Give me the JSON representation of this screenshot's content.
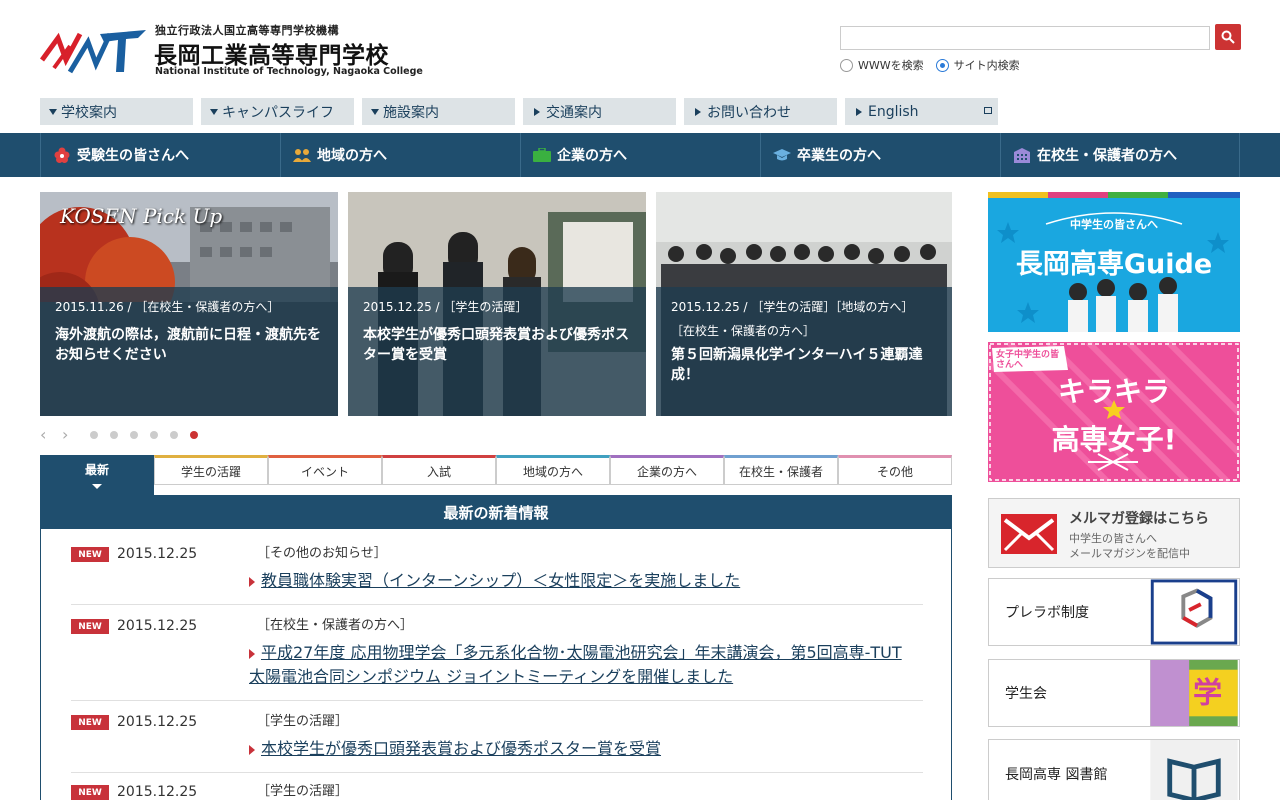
{
  "header": {
    "org": "独立行政法人国立高等専門学校機構",
    "title": "長岡工業高等専門学校",
    "title_en": "National Institute of Technology, Nagaoka College",
    "logo_text": "NCT",
    "search_placeholder": "",
    "radio_www": "WWWを検索",
    "radio_site": "サイト内検索"
  },
  "subnav": [
    {
      "label": "学校案内",
      "icon": "triangle-down-icon"
    },
    {
      "label": "キャンパスライフ",
      "icon": "triangle-down-icon"
    },
    {
      "label": "施設案内",
      "icon": "triangle-down-icon"
    },
    {
      "label": "交通案内",
      "icon": "triangle-right-icon"
    },
    {
      "label": "お問い合わせ",
      "icon": "triangle-right-icon"
    },
    {
      "label": "English",
      "icon": "triangle-right-icon"
    }
  ],
  "mainnav": [
    {
      "label": "受験生の皆さんへ",
      "icon": "flower-icon",
      "color": "#e04040"
    },
    {
      "label": "地域の方へ",
      "icon": "people-icon",
      "color": "#e8a93a"
    },
    {
      "label": "企業の方へ",
      "icon": "briefcase-icon",
      "color": "#3ab040"
    },
    {
      "label": "卒業生の方へ",
      "icon": "graduation-cap-icon",
      "color": "#6ab0e0"
    },
    {
      "label": "在校生・保護者の方へ",
      "icon": "building-icon",
      "color": "#9a8ad8"
    }
  ],
  "slides": [
    {
      "meta": "2015.11.26 / ［在校生・保護者の方へ］",
      "meta2": "",
      "title": "海外渡航の際は，渡航前に日程・渡航先をお知らせください",
      "banner": "KOSEN Pick Up"
    },
    {
      "meta": "2015.12.25 / ［学生の活躍］",
      "meta2": "",
      "title": "本校学生が優秀口頭発表賞および優秀ポスター賞を受賞"
    },
    {
      "meta": "2015.12.25 / ［学生の活躍］［地域の方へ］",
      "meta2": "［在校生・保護者の方へ］",
      "title": "第５回新潟県化学インターハイ５連覇達成！"
    }
  ],
  "slider_dots": 6,
  "slider_active_dot": 6,
  "tabs": [
    {
      "label": "最新",
      "color": "#1f4e6e"
    },
    {
      "label": "学生の活躍",
      "color": "#e0b040"
    },
    {
      "label": "イベント",
      "color": "#e06040"
    },
    {
      "label": "入試",
      "color": "#d04040"
    },
    {
      "label": "地域の方へ",
      "color": "#40a0c0"
    },
    {
      "label": "企業の方へ",
      "color": "#a070c0"
    },
    {
      "label": "在校生・保護者",
      "color": "#70a0d0"
    },
    {
      "label": "その他",
      "color": "#e090b0"
    }
  ],
  "news": {
    "heading": "最新の新着情報",
    "badge": "NEW",
    "items": [
      {
        "date": "2015.12.25",
        "category": "［その他のお知らせ］",
        "lines": [
          "教員職体験実習（インターンシップ）＜女性限定＞を実施しました"
        ]
      },
      {
        "date": "2015.12.25",
        "category": "［在校生・保護者の方へ］",
        "lines": [
          "平成27年度 応用物理学会「多元系化合物･太陽電池研究会」年末講演会，第5回高専-TUT",
          "太陽電池合同シンポジウム ジョイントミーティングを開催しました"
        ]
      },
      {
        "date": "2015.12.25",
        "category": "［学生の活躍］",
        "lines": [
          "本校学生が優秀口頭発表賞および優秀ポスター賞を受賞"
        ]
      },
      {
        "date": "2015.12.25",
        "category": "［学生の活躍］",
        "lines": [
          ""
        ]
      }
    ]
  },
  "side": {
    "guide_small": "中学生の皆さんへ",
    "guide_title": "長岡高専Guide",
    "kira_small": "女子中学生の皆さんへ",
    "kira_line1": "キラキラ",
    "kira_line2": "高専女子!",
    "mail_title": "メルマガ登録はこちら",
    "mail_sub1": "中学生の皆さんへ",
    "mail_sub2": "メールマガジンを配信中",
    "prelabo": "プレラボ制度",
    "student_council": "学生会",
    "library": "長岡高専 図書館"
  }
}
